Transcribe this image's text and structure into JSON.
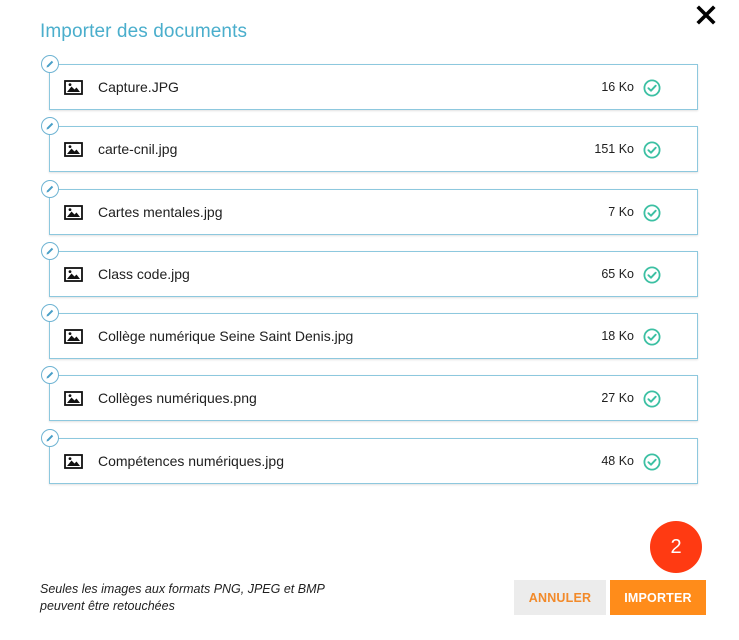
{
  "dialog": {
    "title": "Importer des documents",
    "close_icon": "close-icon"
  },
  "files": [
    {
      "name": "Capture.JPG",
      "size": "16 Ko",
      "status": "uploaded"
    },
    {
      "name": "carte-cnil.jpg",
      "size": "151 Ko",
      "status": "uploaded"
    },
    {
      "name": "Cartes mentales.jpg",
      "size": "7 Ko",
      "status": "uploaded"
    },
    {
      "name": "Class code.jpg",
      "size": "65 Ko",
      "status": "uploaded"
    },
    {
      "name": "Collège numérique Seine Saint Denis.jpg",
      "size": "18 Ko",
      "status": "uploaded"
    },
    {
      "name": "Collèges numériques.png",
      "size": "27 Ko",
      "status": "uploaded"
    },
    {
      "name": "Compétences numériques.jpg",
      "size": "48 Ko",
      "status": "uploaded"
    }
  ],
  "footer": {
    "note_line1": "Seules les images aux formats PNG, JPEG et BMP",
    "note_line2": "peuvent être retouchées",
    "count_badge": "2",
    "cancel_label": "ANNULER",
    "import_label": "IMPORTER"
  },
  "colors": {
    "title": "#4aaecc",
    "card_border": "#8dc8de",
    "check": "#3cc0a3",
    "badge": "#ff3a12",
    "cancel_bg": "#ececec",
    "cancel_text": "#f28a2a",
    "import_bg": "#ff8c1a"
  },
  "icons": {
    "file": "image-file-icon",
    "edit": "pencil-icon",
    "status": "check-circle-icon",
    "close": "close-icon"
  }
}
